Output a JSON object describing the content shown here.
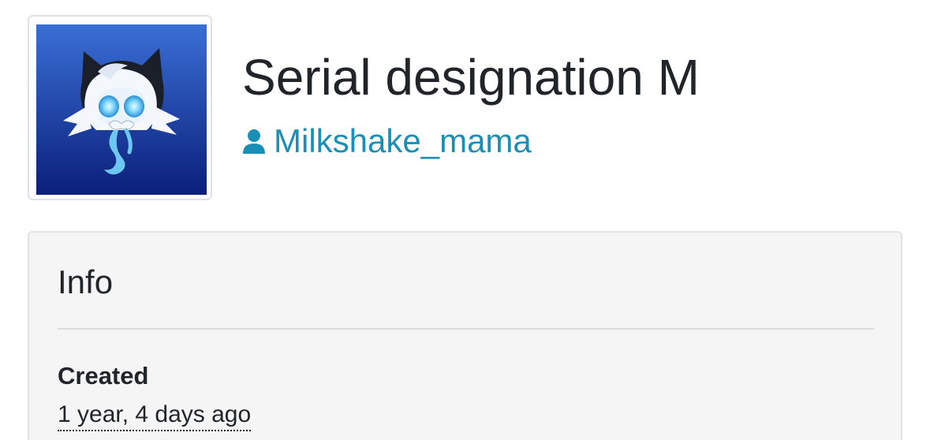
{
  "work": {
    "title": "Serial designation M",
    "author": "Milkshake_mama",
    "author_icon": "user-icon",
    "author_color": "#1a8fb5",
    "avatar_colors": {
      "gradient_top": "#3a6fd6",
      "gradient_bottom": "#0a1f7a",
      "glow": "#7fd6ff"
    }
  },
  "info": {
    "heading": "Info",
    "created_label": "Created",
    "created_value": "1 year, 4 days ago"
  }
}
